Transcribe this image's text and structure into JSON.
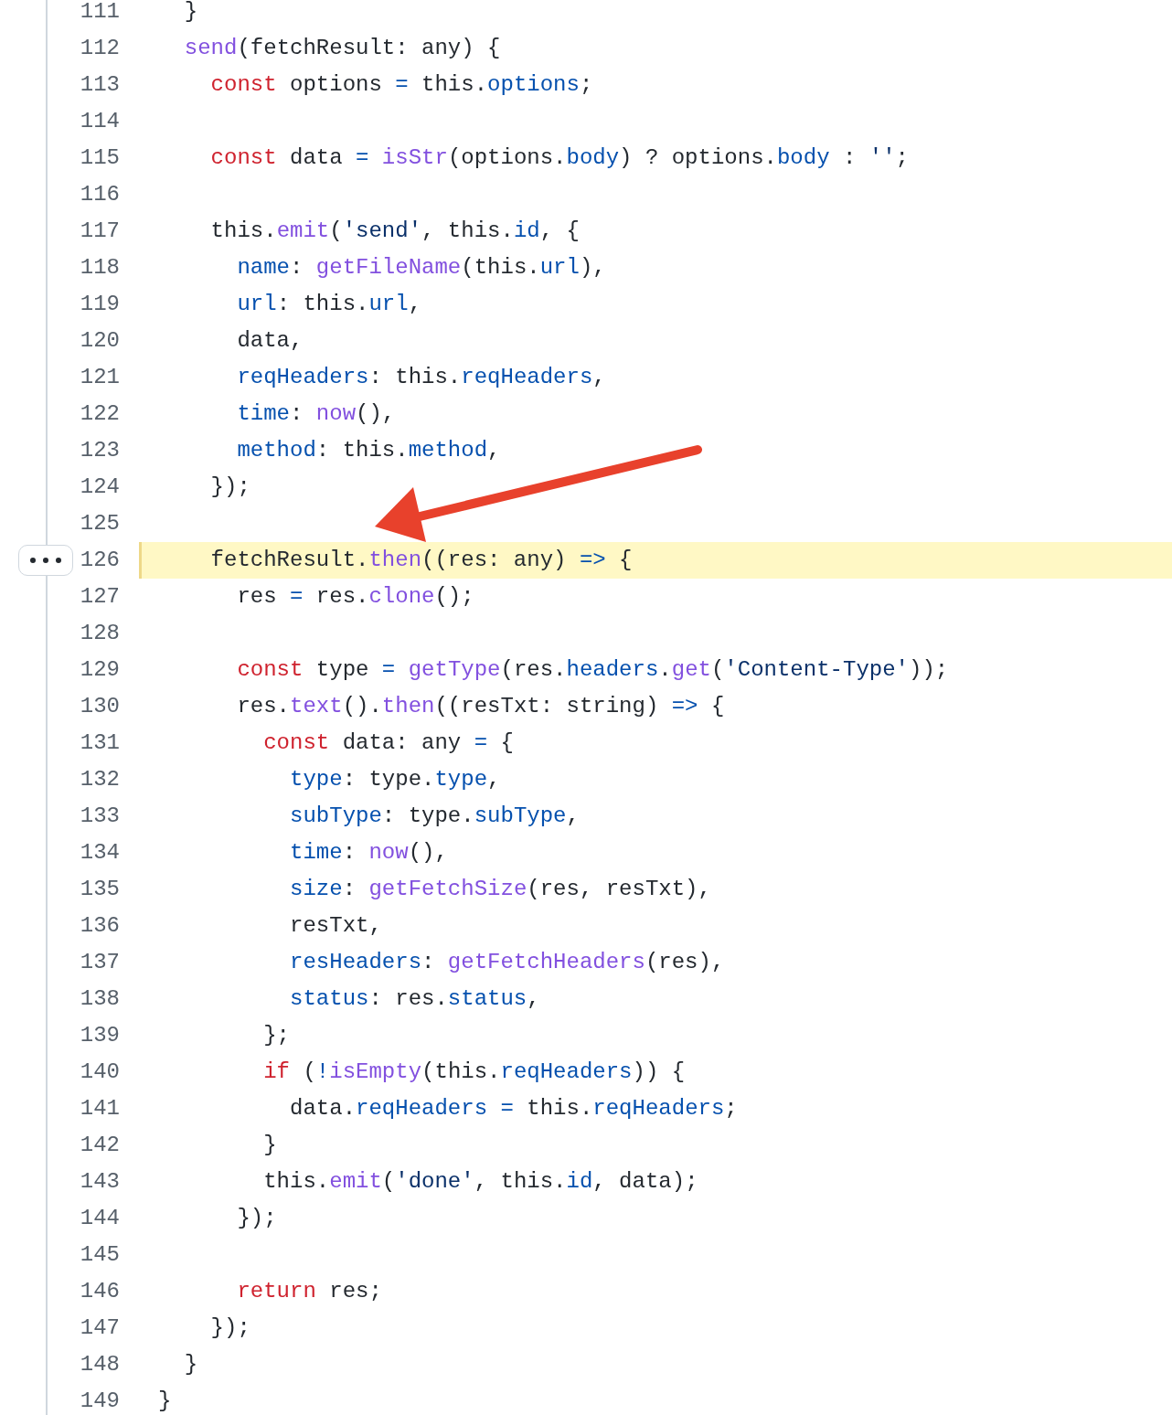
{
  "lines": [
    {
      "number": "111",
      "selected": false,
      "tokens": [
        {
          "kind": "plain",
          "text": "  }"
        }
      ]
    },
    {
      "number": "112",
      "selected": false,
      "tokens": [
        {
          "kind": "function",
          "text": "  send"
        },
        {
          "kind": "plain",
          "text": "(fetchResult: any) {"
        }
      ]
    },
    {
      "number": "113",
      "selected": false,
      "tokens": [
        {
          "kind": "keyword",
          "text": "    const"
        },
        {
          "kind": "plain",
          "text": " options "
        },
        {
          "kind": "operator",
          "text": "="
        },
        {
          "kind": "plain",
          "text": " this."
        },
        {
          "kind": "property",
          "text": "options"
        },
        {
          "kind": "plain",
          "text": ";"
        }
      ]
    },
    {
      "number": "114",
      "selected": false
    },
    {
      "number": "115",
      "selected": false,
      "tokens": [
        {
          "kind": "keyword",
          "text": "    const"
        },
        {
          "kind": "plain",
          "text": " data "
        },
        {
          "kind": "operator",
          "text": "="
        },
        {
          "kind": "function",
          "text": " isStr"
        },
        {
          "kind": "plain",
          "text": "(options."
        },
        {
          "kind": "property",
          "text": "body"
        },
        {
          "kind": "plain",
          "text": ") ? options."
        },
        {
          "kind": "property",
          "text": "body"
        },
        {
          "kind": "plain",
          "text": " : "
        },
        {
          "kind": "string",
          "text": "''"
        },
        {
          "kind": "plain",
          "text": ";"
        }
      ]
    },
    {
      "number": "116",
      "selected": false
    },
    {
      "number": "117",
      "selected": false,
      "tokens": [
        {
          "kind": "plain",
          "text": "    this."
        },
        {
          "kind": "function",
          "text": "emit"
        },
        {
          "kind": "plain",
          "text": "("
        },
        {
          "kind": "string",
          "text": "'send'"
        },
        {
          "kind": "plain",
          "text": ", this."
        },
        {
          "kind": "property",
          "text": "id"
        },
        {
          "kind": "plain",
          "text": ", {"
        }
      ]
    },
    {
      "number": "118",
      "selected": false,
      "tokens": [
        {
          "kind": "property",
          "text": "      name"
        },
        {
          "kind": "plain",
          "text": ": "
        },
        {
          "kind": "function",
          "text": "getFileName"
        },
        {
          "kind": "plain",
          "text": "(this."
        },
        {
          "kind": "property",
          "text": "url"
        },
        {
          "kind": "plain",
          "text": "),"
        }
      ]
    },
    {
      "number": "119",
      "selected": false,
      "tokens": [
        {
          "kind": "property",
          "text": "      url"
        },
        {
          "kind": "plain",
          "text": ": this."
        },
        {
          "kind": "property",
          "text": "url"
        },
        {
          "kind": "plain",
          "text": ","
        }
      ]
    },
    {
      "number": "120",
      "selected": false,
      "tokens": [
        {
          "kind": "plain",
          "text": "      data,"
        }
      ]
    },
    {
      "number": "121",
      "selected": false,
      "tokens": [
        {
          "kind": "property",
          "text": "      reqHeaders"
        },
        {
          "kind": "plain",
          "text": ": this."
        },
        {
          "kind": "property",
          "text": "reqHeaders"
        },
        {
          "kind": "plain",
          "text": ","
        }
      ]
    },
    {
      "number": "122",
      "selected": false,
      "tokens": [
        {
          "kind": "property",
          "text": "      time"
        },
        {
          "kind": "plain",
          "text": ": "
        },
        {
          "kind": "function",
          "text": "now"
        },
        {
          "kind": "plain",
          "text": "(),"
        }
      ]
    },
    {
      "number": "123",
      "selected": false,
      "tokens": [
        {
          "kind": "property",
          "text": "      method"
        },
        {
          "kind": "plain",
          "text": ": this."
        },
        {
          "kind": "property",
          "text": "method"
        },
        {
          "kind": "plain",
          "text": ","
        }
      ]
    },
    {
      "number": "124",
      "selected": false,
      "tokens": [
        {
          "kind": "plain",
          "text": "    });"
        }
      ]
    },
    {
      "number": "125",
      "selected": false
    },
    {
      "number": "126",
      "selected": true,
      "tokens": [
        {
          "kind": "plain",
          "text": "    fetchResult."
        },
        {
          "kind": "function",
          "text": "then"
        },
        {
          "kind": "plain",
          "text": "((res: any) "
        },
        {
          "kind": "operator",
          "text": "=>"
        },
        {
          "kind": "plain",
          "text": " {"
        }
      ]
    },
    {
      "number": "127",
      "selected": false,
      "tokens": [
        {
          "kind": "plain",
          "text": "      res "
        },
        {
          "kind": "operator",
          "text": "="
        },
        {
          "kind": "plain",
          "text": " res."
        },
        {
          "kind": "function",
          "text": "clone"
        },
        {
          "kind": "plain",
          "text": "();"
        }
      ]
    },
    {
      "number": "128",
      "selected": false
    },
    {
      "number": "129",
      "selected": false,
      "tokens": [
        {
          "kind": "keyword",
          "text": "      const"
        },
        {
          "kind": "plain",
          "text": " type "
        },
        {
          "kind": "operator",
          "text": "="
        },
        {
          "kind": "function",
          "text": " getType"
        },
        {
          "kind": "plain",
          "text": "(res."
        },
        {
          "kind": "property",
          "text": "headers"
        },
        {
          "kind": "plain",
          "text": "."
        },
        {
          "kind": "function",
          "text": "get"
        },
        {
          "kind": "plain",
          "text": "("
        },
        {
          "kind": "string",
          "text": "'Content-Type'"
        },
        {
          "kind": "plain",
          "text": "));"
        }
      ]
    },
    {
      "number": "130",
      "selected": false,
      "tokens": [
        {
          "kind": "plain",
          "text": "      res."
        },
        {
          "kind": "function",
          "text": "text"
        },
        {
          "kind": "plain",
          "text": "()."
        },
        {
          "kind": "function",
          "text": "then"
        },
        {
          "kind": "plain",
          "text": "((resTxt: string) "
        },
        {
          "kind": "operator",
          "text": "=>"
        },
        {
          "kind": "plain",
          "text": " {"
        }
      ]
    },
    {
      "number": "131",
      "selected": false,
      "tokens": [
        {
          "kind": "keyword",
          "text": "        const"
        },
        {
          "kind": "plain",
          "text": " data: any "
        },
        {
          "kind": "operator",
          "text": "="
        },
        {
          "kind": "plain",
          "text": " {"
        }
      ]
    },
    {
      "number": "132",
      "selected": false,
      "tokens": [
        {
          "kind": "property",
          "text": "          type"
        },
        {
          "kind": "plain",
          "text": ": type."
        },
        {
          "kind": "property",
          "text": "type"
        },
        {
          "kind": "plain",
          "text": ","
        }
      ]
    },
    {
      "number": "133",
      "selected": false,
      "tokens": [
        {
          "kind": "property",
          "text": "          subType"
        },
        {
          "kind": "plain",
          "text": ": type."
        },
        {
          "kind": "property",
          "text": "subType"
        },
        {
          "kind": "plain",
          "text": ","
        }
      ]
    },
    {
      "number": "134",
      "selected": false,
      "tokens": [
        {
          "kind": "property",
          "text": "          time"
        },
        {
          "kind": "plain",
          "text": ": "
        },
        {
          "kind": "function",
          "text": "now"
        },
        {
          "kind": "plain",
          "text": "(),"
        }
      ]
    },
    {
      "number": "135",
      "selected": false,
      "tokens": [
        {
          "kind": "property",
          "text": "          size"
        },
        {
          "kind": "plain",
          "text": ": "
        },
        {
          "kind": "function",
          "text": "getFetchSize"
        },
        {
          "kind": "plain",
          "text": "(res, resTxt),"
        }
      ]
    },
    {
      "number": "136",
      "selected": false,
      "tokens": [
        {
          "kind": "plain",
          "text": "          resTxt,"
        }
      ]
    },
    {
      "number": "137",
      "selected": false,
      "tokens": [
        {
          "kind": "property",
          "text": "          resHeaders"
        },
        {
          "kind": "plain",
          "text": ": "
        },
        {
          "kind": "function",
          "text": "getFetchHeaders"
        },
        {
          "kind": "plain",
          "text": "(res),"
        }
      ]
    },
    {
      "number": "138",
      "selected": false,
      "tokens": [
        {
          "kind": "property",
          "text": "          status"
        },
        {
          "kind": "plain",
          "text": ": res."
        },
        {
          "kind": "property",
          "text": "status"
        },
        {
          "kind": "plain",
          "text": ","
        }
      ]
    },
    {
      "number": "139",
      "selected": false,
      "tokens": [
        {
          "kind": "plain",
          "text": "        };"
        }
      ]
    },
    {
      "number": "140",
      "selected": false,
      "tokens": [
        {
          "kind": "keyword",
          "text": "        if"
        },
        {
          "kind": "plain",
          "text": " ("
        },
        {
          "kind": "operator",
          "text": "!"
        },
        {
          "kind": "function",
          "text": "isEmpty"
        },
        {
          "kind": "plain",
          "text": "(this."
        },
        {
          "kind": "property",
          "text": "reqHeaders"
        },
        {
          "kind": "plain",
          "text": ")) {"
        }
      ]
    },
    {
      "number": "141",
      "selected": false,
      "tokens": [
        {
          "kind": "plain",
          "text": "          data."
        },
        {
          "kind": "property",
          "text": "reqHeaders"
        },
        {
          "kind": "operator",
          "text": " ="
        },
        {
          "kind": "plain",
          "text": " this."
        },
        {
          "kind": "property",
          "text": "reqHeaders"
        },
        {
          "kind": "plain",
          "text": ";"
        }
      ]
    },
    {
      "number": "142",
      "selected": false,
      "tokens": [
        {
          "kind": "plain",
          "text": "        }"
        }
      ]
    },
    {
      "number": "143",
      "selected": false,
      "tokens": [
        {
          "kind": "plain",
          "text": "        this."
        },
        {
          "kind": "function",
          "text": "emit"
        },
        {
          "kind": "plain",
          "text": "("
        },
        {
          "kind": "string",
          "text": "'done'"
        },
        {
          "kind": "plain",
          "text": ", this."
        },
        {
          "kind": "property",
          "text": "id"
        },
        {
          "kind": "plain",
          "text": ", data);"
        }
      ]
    },
    {
      "number": "144",
      "selected": false,
      "tokens": [
        {
          "kind": "plain",
          "text": "      });"
        }
      ]
    },
    {
      "number": "145",
      "selected": false
    },
    {
      "number": "146",
      "selected": false,
      "tokens": [
        {
          "kind": "keyword",
          "text": "      return"
        },
        {
          "kind": "plain",
          "text": " res;"
        }
      ]
    },
    {
      "number": "147",
      "selected": false,
      "tokens": [
        {
          "kind": "plain",
          "text": "    });"
        }
      ]
    },
    {
      "number": "148",
      "selected": false,
      "tokens": [
        {
          "kind": "plain",
          "text": "  }"
        }
      ]
    },
    {
      "number": "149",
      "selected": false,
      "tokens": [
        {
          "kind": "plain",
          "text": "}"
        }
      ]
    }
  ]
}
